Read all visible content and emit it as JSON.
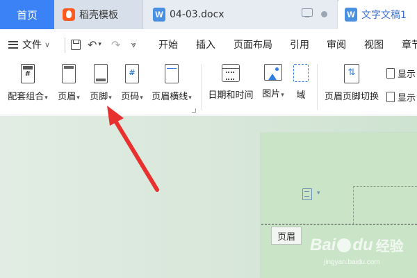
{
  "tabs": {
    "home": "首页",
    "template": "稻壳模板",
    "doc1": "04-03.docx",
    "doc2": "文字文稿1",
    "w_glyph": "W"
  },
  "menu": {
    "file": "文件",
    "items": [
      "开始",
      "插入",
      "页面布局",
      "引用",
      "审阅",
      "视图",
      "章节"
    ]
  },
  "ribbon": {
    "combo": "配套组合",
    "header": "页眉",
    "footer": "页脚",
    "page_number": "页码",
    "header_line": "页眉横线",
    "datetime": "日期和时间",
    "picture": "图片",
    "field": "域",
    "switch": "页眉页脚切换",
    "show1": "显示",
    "show2": "显示"
  },
  "document": {
    "header_tag": "页眉"
  },
  "watermark": {
    "brand": "Bai",
    "brand2": "du",
    "jingyan": "经验",
    "url": "jingyan.baidu.com"
  },
  "colors": {
    "accent": "#3b82f6",
    "arrow": "#e8312f",
    "canvas": "#cfe3d1"
  }
}
